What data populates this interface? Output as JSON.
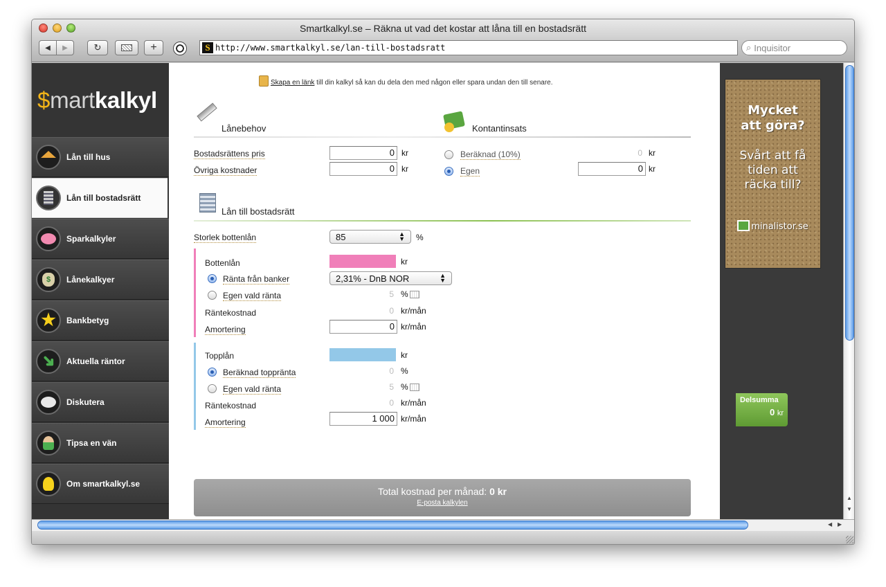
{
  "window": {
    "title": "Smartkalkyl.se – Räkna ut vad det kostar att låna till en bostadsrätt",
    "url": "http://www.smartkalkyl.se/lan-till-bostadsratt",
    "search_placeholder": "Inquisitor"
  },
  "toolbar": {
    "back": "◀",
    "forward": "▶",
    "reload": "↻",
    "add": "+"
  },
  "logo": {
    "dollar": "$",
    "mart": "mart",
    "kalkyl": "kalkyl"
  },
  "sidebar": {
    "items": [
      {
        "label": "Lån till hus",
        "icon": "house-icon"
      },
      {
        "label": "Lån till bostadsrätt",
        "icon": "building-icon"
      },
      {
        "label": "Sparkalkyler",
        "icon": "piggy-bank-icon"
      },
      {
        "label": "Lånekalkyer",
        "icon": "money-bag-icon"
      },
      {
        "label": "Bankbetyg",
        "icon": "star-icon"
      },
      {
        "label": "Aktuella räntor",
        "icon": "arrow-up-icon"
      },
      {
        "label": "Diskutera",
        "icon": "speech-bubble-icon"
      },
      {
        "label": "Tipsa en vän",
        "icon": "person-icon"
      },
      {
        "label": "Om smartkalkyl.se",
        "icon": "lightbulb-icon"
      }
    ]
  },
  "share": {
    "link": "Skapa en länk",
    "text": "till din kalkyl så kan du dela den med någon eller spara undan den till senare."
  },
  "lanebehov": {
    "title": "Lånebehov",
    "price_label": "Bostadsrättens pris",
    "price_value": "0",
    "other_label": "Övriga kostnader",
    "other_value": "0",
    "unit": "kr"
  },
  "kontantinsats": {
    "title": "Kontantinsats",
    "calc_label": "Beräknad (10%)",
    "calc_value": "0",
    "own_label": "Egen",
    "own_value": "0",
    "unit": "kr"
  },
  "lan": {
    "title": "Lån till bostadsrätt",
    "size_label": "Storlek bottenlån",
    "size_value": "85",
    "size_unit": "%"
  },
  "bottenlan": {
    "title": "Bottenlån",
    "amount_unit": "kr",
    "bank_rate_label": "Ränta från banker",
    "bank_rate_value": "2,31% - DnB NOR",
    "own_rate_label": "Egen vald ränta",
    "own_rate_value": "5",
    "rate_unit": "%",
    "cost_label": "Räntekostnad",
    "cost_value": "0",
    "cost_unit": "kr/mån",
    "amort_label": "Amortering",
    "amort_value": "0",
    "amort_unit": "kr/mån"
  },
  "topplan": {
    "title": "Topplån",
    "amount_unit": "kr",
    "calc_rate_label": "Beräknad toppränta",
    "calc_rate_value": "0",
    "own_rate_label": "Egen vald ränta",
    "own_rate_value": "5",
    "rate_unit": "%",
    "cost_label": "Räntekostnad",
    "cost_value": "0",
    "cost_unit": "kr/mån",
    "amort_label": "Amortering",
    "amort_value": "1 000",
    "amort_unit": "kr/mån"
  },
  "total": {
    "label": "Total kostnad per månad:",
    "value": "0 kr",
    "email": "E-posta kalkylen"
  },
  "ad": {
    "line1": "Mycket att göra?",
    "line2": "Svårt att få tiden att räcka till?",
    "brand": "minalistor.se"
  },
  "delsumma": {
    "label": "Delsumma",
    "value": "0",
    "unit": "kr"
  },
  "colors": {
    "bottenlan": "#f07fb9",
    "topplan": "#93c8e8",
    "accent": "#8cc152"
  }
}
